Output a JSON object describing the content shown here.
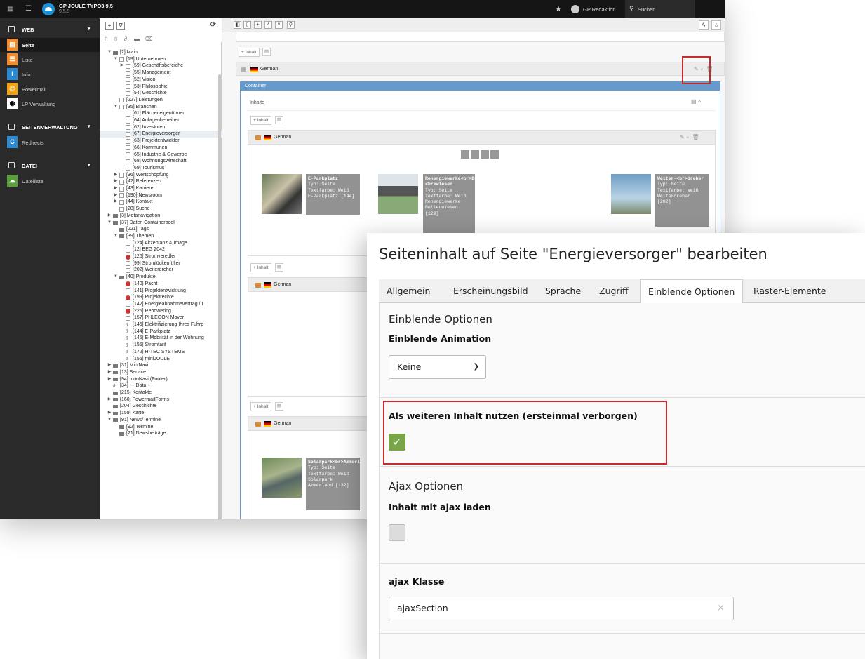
{
  "topbar": {
    "app_title": "GP JOULE TYPO3 9.5",
    "version": "9.5.9",
    "user": "GP Redaktion",
    "search_label": "Suchen"
  },
  "module_menu": {
    "groups": [
      {
        "label": "WEB",
        "items": [
          "Seite",
          "Liste",
          "Info",
          "Powermail",
          "LP Verwaltung"
        ]
      },
      {
        "label": "SEITENVERWALTUNG",
        "items": [
          "Redirects"
        ]
      },
      {
        "label": "DATEI",
        "items": [
          "Dateiliste"
        ]
      }
    ],
    "active": "Seite"
  },
  "page_tree": [
    {
      "label": "[2] Main",
      "depth": 0,
      "toggle": "▼",
      "icon": "folder"
    },
    {
      "label": "[19] Unternehmen",
      "depth": 1,
      "toggle": "▼",
      "icon": "page"
    },
    {
      "label": "[59] Geschäftsbereiche",
      "depth": 2,
      "toggle": "▶",
      "icon": "page"
    },
    {
      "label": "[55] Management",
      "depth": 2,
      "toggle": "",
      "icon": "page"
    },
    {
      "label": "[52] Vision",
      "depth": 2,
      "toggle": "",
      "icon": "page"
    },
    {
      "label": "[53] Philosophie",
      "depth": 2,
      "toggle": "",
      "icon": "page"
    },
    {
      "label": "[54] Geschichte",
      "depth": 2,
      "toggle": "",
      "icon": "page"
    },
    {
      "label": "[227] Leistungen",
      "depth": 1,
      "toggle": "",
      "icon": "page"
    },
    {
      "label": "[35] Branchen",
      "depth": 1,
      "toggle": "▼",
      "icon": "page"
    },
    {
      "label": "[61] Flächeneigentümer",
      "depth": 2,
      "toggle": "",
      "icon": "page"
    },
    {
      "label": "[64] Anlagenbetreiber",
      "depth": 2,
      "toggle": "",
      "icon": "page"
    },
    {
      "label": "[62] Investoren",
      "depth": 2,
      "toggle": "",
      "icon": "page"
    },
    {
      "label": "[67] Energieversorger",
      "depth": 2,
      "toggle": "",
      "icon": "page",
      "selected": true
    },
    {
      "label": "[63] Projektentwickler",
      "depth": 2,
      "toggle": "",
      "icon": "page"
    },
    {
      "label": "[66] Kommunen",
      "depth": 2,
      "toggle": "",
      "icon": "page"
    },
    {
      "label": "[65] Industrie & Gewerbe",
      "depth": 2,
      "toggle": "",
      "icon": "page"
    },
    {
      "label": "[68] Wohnungswirtschaft",
      "depth": 2,
      "toggle": "",
      "icon": "page"
    },
    {
      "label": "[69] Tourismus",
      "depth": 2,
      "toggle": "",
      "icon": "page"
    },
    {
      "label": "[36] Wertschöpfung",
      "depth": 1,
      "toggle": "▶",
      "icon": "page"
    },
    {
      "label": "[42] Referenzen",
      "depth": 1,
      "toggle": "▶",
      "icon": "page"
    },
    {
      "label": "[43] Karriere",
      "depth": 1,
      "toggle": "▶",
      "icon": "page"
    },
    {
      "label": "[190] Newsroom",
      "depth": 1,
      "toggle": "▶",
      "icon": "page"
    },
    {
      "label": "[44] Kontakt",
      "depth": 1,
      "toggle": "▶",
      "icon": "page"
    },
    {
      "label": "[28] Suche",
      "depth": 1,
      "toggle": "",
      "icon": "page"
    },
    {
      "label": "[3] Metanavigation",
      "depth": 0,
      "toggle": "▶",
      "icon": "folder"
    },
    {
      "label": "[37] Daten Containerpool",
      "depth": 0,
      "toggle": "▼",
      "icon": "folder"
    },
    {
      "label": "[221] Tags",
      "depth": 1,
      "toggle": "",
      "icon": "folder"
    },
    {
      "label": "[39] Themen",
      "depth": 1,
      "toggle": "▼",
      "icon": "folder"
    },
    {
      "label": "[124] Akzeptanz & Image",
      "depth": 2,
      "toggle": "",
      "icon": "page"
    },
    {
      "label": "[12] EEG 2042",
      "depth": 2,
      "toggle": "",
      "icon": "page"
    },
    {
      "label": "[126] Stromveredler",
      "depth": 2,
      "toggle": "",
      "icon": "hidden"
    },
    {
      "label": "[99] Stromlückenfüller",
      "depth": 2,
      "toggle": "",
      "icon": "page"
    },
    {
      "label": "[202] Weiterdreher",
      "depth": 2,
      "toggle": "",
      "icon": "page"
    },
    {
      "label": "[40] Produkte",
      "depth": 1,
      "toggle": "▼",
      "icon": "folder"
    },
    {
      "label": "[140] Pacht",
      "depth": 2,
      "toggle": "",
      "icon": "hidden"
    },
    {
      "label": "[141] Projektentwicklung",
      "depth": 2,
      "toggle": "",
      "icon": "page"
    },
    {
      "label": "[199] Projektrechte",
      "depth": 2,
      "toggle": "",
      "icon": "hidden"
    },
    {
      "label": "[142] Energieabnahmevertrag / I",
      "depth": 2,
      "toggle": "",
      "icon": "page"
    },
    {
      "label": "[225] Repowering",
      "depth": 2,
      "toggle": "",
      "icon": "hidden"
    },
    {
      "label": "[157] PHLEGON Mover",
      "depth": 2,
      "toggle": "",
      "icon": "page"
    },
    {
      "label": "[146] Elektrifizierung Ihres Fuhrp",
      "depth": 2,
      "toggle": "",
      "icon": "link"
    },
    {
      "label": "[144] E-Parkplatz",
      "depth": 2,
      "toggle": "",
      "icon": "link"
    },
    {
      "label": "[145] E-Mobilität in der Wohnung",
      "depth": 2,
      "toggle": "",
      "icon": "link"
    },
    {
      "label": "[155] Stromtarif",
      "depth": 2,
      "toggle": "",
      "icon": "link"
    },
    {
      "label": "[172] H-TEC SYSTEMS",
      "depth": 2,
      "toggle": "",
      "icon": "link"
    },
    {
      "label": "[156] miniJOULE",
      "depth": 2,
      "toggle": "",
      "icon": "link"
    },
    {
      "label": "[31] MiniNavi",
      "depth": 0,
      "toggle": "▶",
      "icon": "folder"
    },
    {
      "label": "[13] Service",
      "depth": 0,
      "toggle": "▶",
      "icon": "folder"
    },
    {
      "label": "[94] IconNavi (Footer)",
      "depth": 0,
      "toggle": "▶",
      "icon": "folder"
    },
    {
      "label": "[34] --- Data ---",
      "depth": 0,
      "toggle": "",
      "icon": "link"
    },
    {
      "label": "[215] Kontakte",
      "depth": 0,
      "toggle": "",
      "icon": "folder"
    },
    {
      "label": "[160] PowermailForms",
      "depth": 0,
      "toggle": "▶",
      "icon": "folder"
    },
    {
      "label": "[204] Geschichte",
      "depth": 0,
      "toggle": "",
      "icon": "folder"
    },
    {
      "label": "[159] Karte",
      "depth": 0,
      "toggle": "▶",
      "icon": "folder"
    },
    {
      "label": "[91] News/Termine",
      "depth": 0,
      "toggle": "▼",
      "icon": "folder"
    },
    {
      "label": "[92] Termine",
      "depth": 1,
      "toggle": "",
      "icon": "folder"
    },
    {
      "label": "[21] Newsbeiträge",
      "depth": 1,
      "toggle": "",
      "icon": "folder"
    }
  ],
  "content": {
    "add_label": "+ Inhalt",
    "language": "German",
    "container_label": "Container",
    "inhalte_label": "Inhalte",
    "cards_row1": [
      {
        "title": "E-Parkplatz",
        "lines": [
          "Typ: Seite",
          "Textfarbe: Weiß",
          "E-Parkplatz [144]"
        ]
      },
      {
        "title": "Renergiewerke<br>Butten-<br>wiesen",
        "lines": [
          "Typ: Seite",
          "Textfarbe: Weiß",
          "Renergiewerke",
          "Buttenwiesen",
          "[129]"
        ]
      },
      {
        "title": "Weiter-<br>dreher",
        "lines": [
          "Typ: Seite",
          "Textfarbe: Weiß",
          "Weiterdreher",
          "[202]"
        ]
      }
    ],
    "card_row3": {
      "title": "Solarpark<br>Ammerland",
      "lines": [
        "Typ: Seite",
        "Textfarbe: Weiß",
        "Solarpark",
        "Ammerland [132]"
      ]
    }
  },
  "dialog": {
    "title": "Seiteninhalt auf Seite \"Energieversorger\" bearbeiten",
    "tabs": [
      "Allgemein",
      "Erscheinungsbild",
      "Sprache",
      "Zugriff",
      "Einblende Optionen",
      "Raster-Elemente"
    ],
    "active_tab": "Einblende Optionen",
    "section1_heading": "Einblende Optionen",
    "animation_label": "Einblende Animation",
    "animation_value": "Keine",
    "hidden_content_label": "Als weiteren Inhalt nutzen (ersteinmal verborgen)",
    "hidden_content_checked": true,
    "section2_heading": "Ajax Optionen",
    "ajax_label": "Inhalt mit ajax laden",
    "ajax_checked": false,
    "ajax_class_label": "ajax Klasse",
    "ajax_class_value": "ajaxSection"
  },
  "colors": {
    "checkbox_on": "#79a548",
    "highlight_box": "#cc2a2a",
    "container_header": "#6699cc"
  }
}
